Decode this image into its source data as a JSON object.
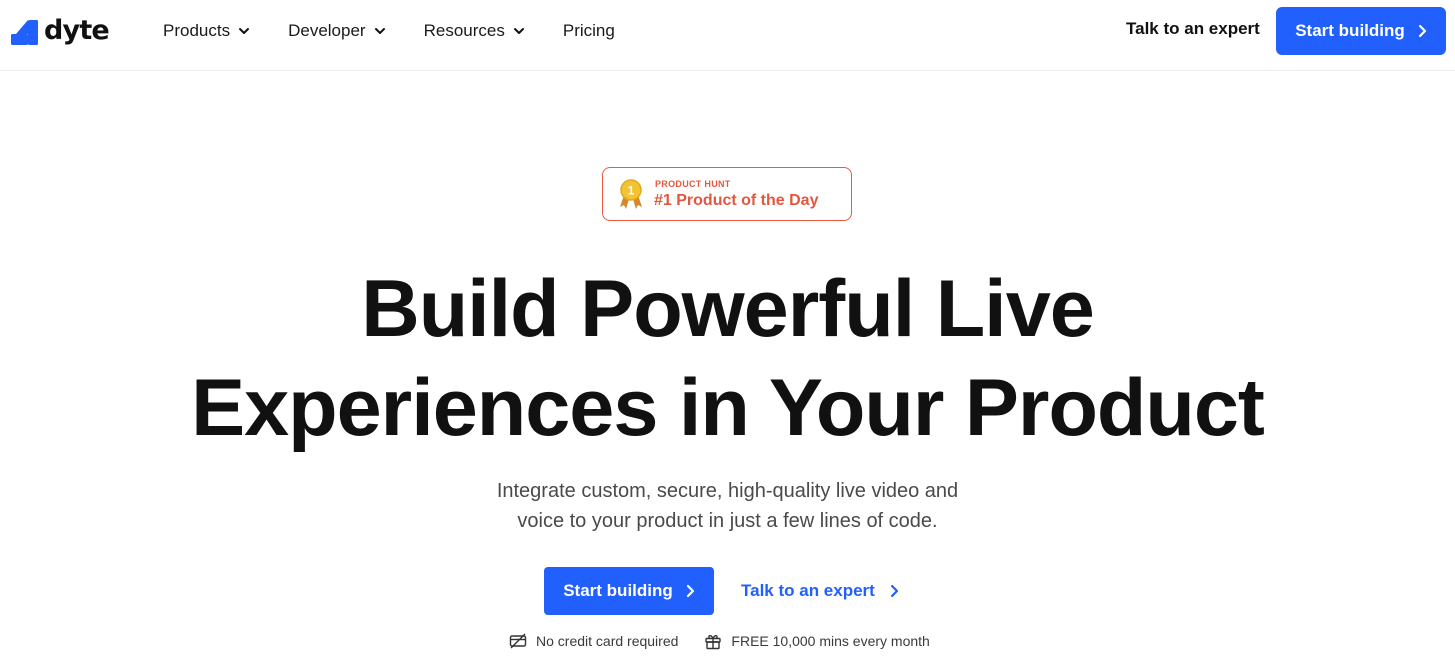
{
  "brand": {
    "name": "dyte",
    "accent": "#2160fd",
    "badge_color": "#e2583f"
  },
  "header": {
    "nav": [
      {
        "label": "Products",
        "has_dropdown": true
      },
      {
        "label": "Developer",
        "has_dropdown": true
      },
      {
        "label": "Resources",
        "has_dropdown": true
      },
      {
        "label": "Pricing",
        "has_dropdown": false
      }
    ],
    "talk_label": "Talk to an expert",
    "start_label": "Start building"
  },
  "badge": {
    "label": "PRODUCT HUNT",
    "title": "#1 Product of the Day",
    "medal_number": "1",
    "icon": "medal-icon"
  },
  "hero": {
    "title_line1": "Build Powerful Live",
    "title_line2": "Experiences in Your Product",
    "subtitle_line1": "Integrate custom, secure, high-quality live video and",
    "subtitle_line2": "voice to your product in just a few lines of code.",
    "cta_primary": "Start building",
    "cta_secondary": "Talk to an expert"
  },
  "perks": [
    {
      "icon": "no-credit-card-icon",
      "label": "No credit card required"
    },
    {
      "icon": "gift-icon",
      "label": "FREE 10,000 mins every month"
    }
  ]
}
